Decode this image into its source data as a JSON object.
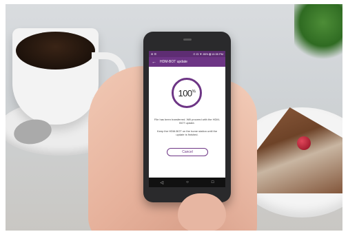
{
  "status_bar": {
    "left": "⊕ ☰",
    "right": "⊙ ☊ ▼ 85% ▮ 10:35 PM"
  },
  "app_bar": {
    "back_glyph": "←",
    "title": "HDM-BOT update"
  },
  "progress": {
    "value": "100",
    "unit": "%",
    "fraction": 1.0
  },
  "messages": {
    "line1": "File has been transferred. Will proceed with the HDM-BOT update.",
    "line2": "Keep the HDM-BOT on the home station until the update is finished."
  },
  "cancel_label": "Cancel",
  "nav": {
    "back": "◁",
    "home": "○",
    "recent": "□"
  },
  "colors": {
    "accent": "#6d3585",
    "status_bar": "#5e2d73"
  }
}
